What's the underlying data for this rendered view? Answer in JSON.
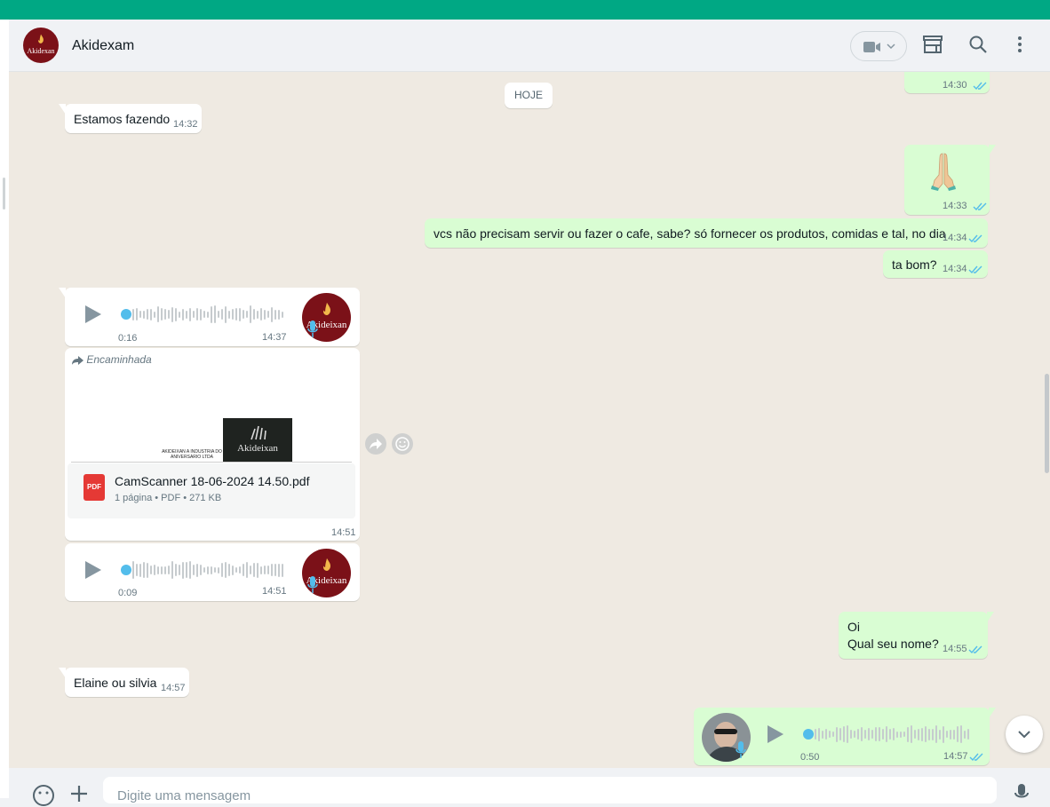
{
  "header": {
    "contact_name": "Akidexam",
    "avatar_brand": "Akidexan",
    "icons": [
      "video-camera-icon",
      "chevron-down-icon",
      "store-icon",
      "search-icon",
      "menu-dots-icon"
    ]
  },
  "chat": {
    "day_label": "HOJE",
    "messages": [
      {
        "direction": "out",
        "type": "partial",
        "time": "14:30"
      },
      {
        "direction": "in",
        "type": "text",
        "text": "Estamos fazendo",
        "time": "14:32"
      },
      {
        "direction": "out",
        "type": "emoji",
        "emoji": "🙏🏻",
        "time": "14:33"
      },
      {
        "direction": "out",
        "type": "text",
        "text": "vcs não precisam servir ou fazer o cafe, sabe? só fornecer os produtos, comidas e tal, no dia",
        "time": "14:34"
      },
      {
        "direction": "out",
        "type": "text",
        "text": "ta bom?",
        "time": "14:34"
      },
      {
        "direction": "in",
        "type": "audio",
        "duration": "0:16",
        "time": "14:37",
        "avatar_brand": "Akideixan"
      },
      {
        "direction": "in",
        "type": "document",
        "forwarded_label": "Encaminhada",
        "preview_brand": "Akideixan",
        "preview_caption": "AKIDEIXAN A INDUSTRIA DO ANIVERSARIO LTDA",
        "file_name": "CamScanner 18-06-2024 14.50.pdf",
        "file_meta": "1 página • PDF • 271 KB",
        "file_icon": "PDF",
        "time": "14:51"
      },
      {
        "direction": "in",
        "type": "audio",
        "duration": "0:09",
        "time": "14:51",
        "avatar_brand": "Akideixan"
      },
      {
        "direction": "out",
        "type": "text",
        "line1": "Oi",
        "line2": "Qual seu nome?",
        "time": "14:55"
      },
      {
        "direction": "in",
        "type": "text",
        "text": "Elaine ou silvia",
        "time": "14:57"
      },
      {
        "direction": "out",
        "type": "audio",
        "duration": "0:50",
        "time": "14:57"
      }
    ]
  },
  "composer": {
    "placeholder": "Digite uma mensagem"
  },
  "colors": {
    "accent": "#00a884",
    "outgoing": "#d9fdd3",
    "incoming": "#ffffff",
    "chat_bg": "#efeae2",
    "read_ticks": "#53bdeb"
  }
}
